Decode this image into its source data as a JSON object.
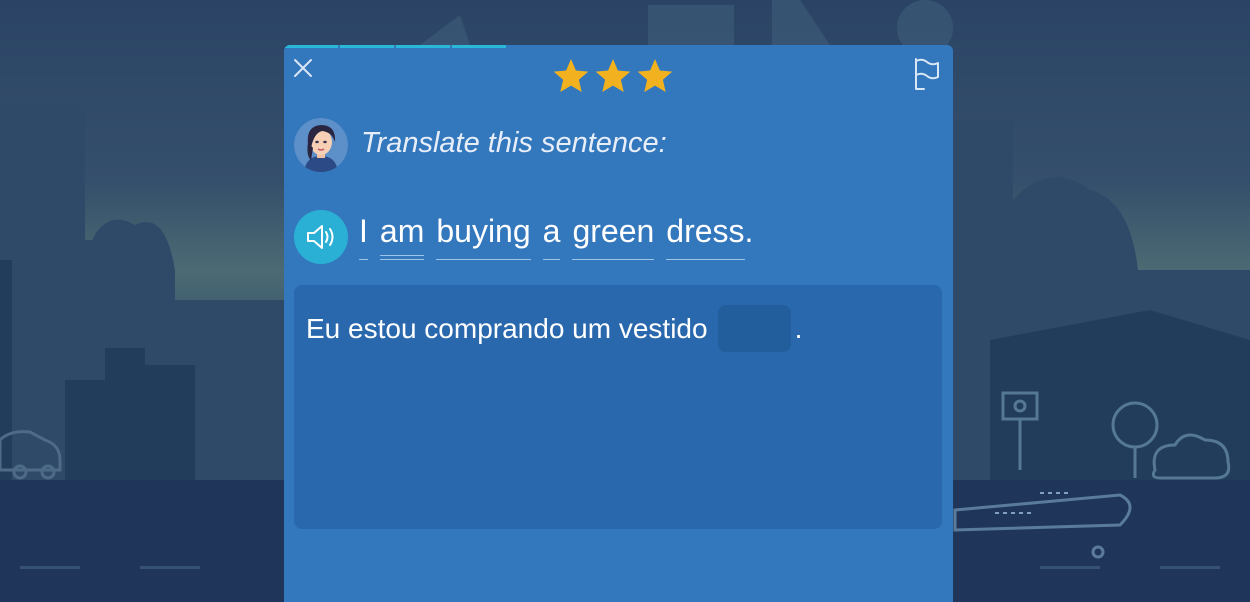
{
  "exercise": {
    "progress_segments_done": 4,
    "stars": 3,
    "instruction": "Translate this sentence:",
    "source_sentence": {
      "words": [
        "I",
        "am",
        "buying",
        "a",
        "green",
        "dress"
      ],
      "end_punctuation": "."
    },
    "answer": {
      "text": "Eu estou comprando um vestido",
      "end_punctuation": ".",
      "blank_value": ""
    }
  },
  "icons": {
    "close": "close-icon",
    "star": "star-icon",
    "flag": "flag-icon",
    "sound": "speaker-icon",
    "avatar": "tutor-avatar"
  },
  "colors": {
    "card": "#3377bd",
    "answer_box": "#2a68ae",
    "blank": "#225d9c",
    "progress": "#2ab8d8",
    "star": "#f2b21f",
    "sound_button": "#2ab0d4"
  }
}
